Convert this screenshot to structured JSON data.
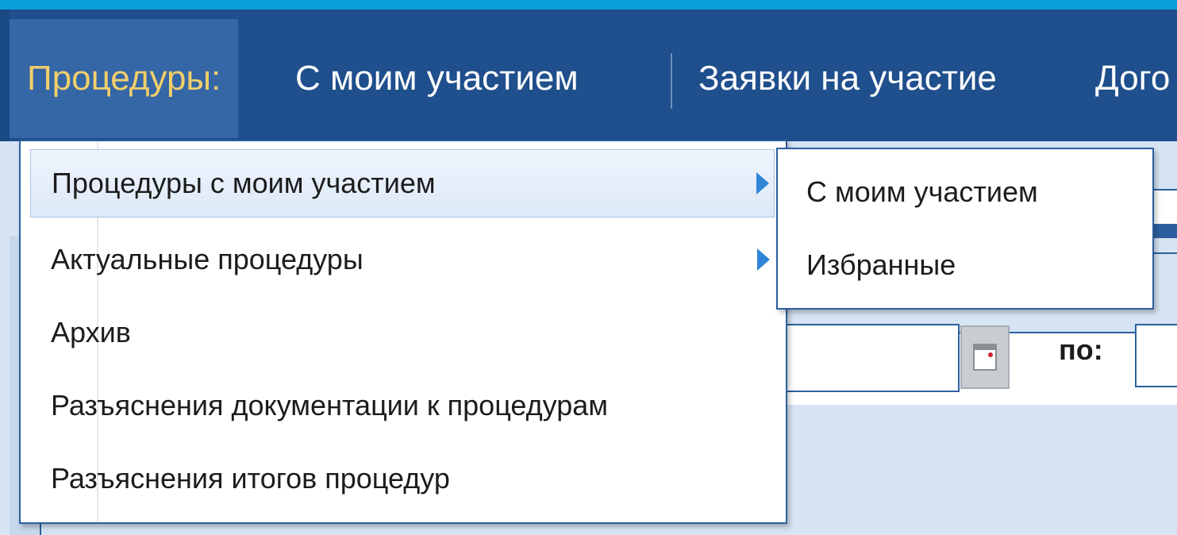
{
  "navbar": {
    "items": [
      {
        "label": "Процедуры:",
        "active": true
      },
      {
        "label": "С моим участием",
        "active": false
      },
      {
        "label": "Заявки на участие",
        "active": false
      },
      {
        "label": "Дого",
        "active": false
      }
    ]
  },
  "dropdown": {
    "items": [
      {
        "label": "Процедуры с моим участием",
        "has_submenu": true,
        "highlighted": true
      },
      {
        "label": "Актуальные процедуры",
        "has_submenu": true,
        "highlighted": false
      },
      {
        "label": "Архив",
        "has_submenu": false,
        "highlighted": false
      },
      {
        "label": "Разъяснения документации к процедурам",
        "has_submenu": false,
        "highlighted": false
      },
      {
        "label": "Разъяснения итогов процедур",
        "has_submenu": false,
        "highlighted": false
      }
    ]
  },
  "submenu": {
    "items": [
      {
        "label": "С моим участием"
      },
      {
        "label": "Избранные"
      }
    ]
  },
  "filter": {
    "to_label": "по:",
    "calendar_icon": "calendar-icon"
  },
  "colors": {
    "navbar_bg": "#1f4f8c",
    "active_tab_bg": "#3566a6",
    "active_tab_text": "#f1cf6a",
    "top_stripe": "#0b9fda",
    "menu_border": "#2c5fa0",
    "submenu_arrow": "#2f86d6"
  }
}
